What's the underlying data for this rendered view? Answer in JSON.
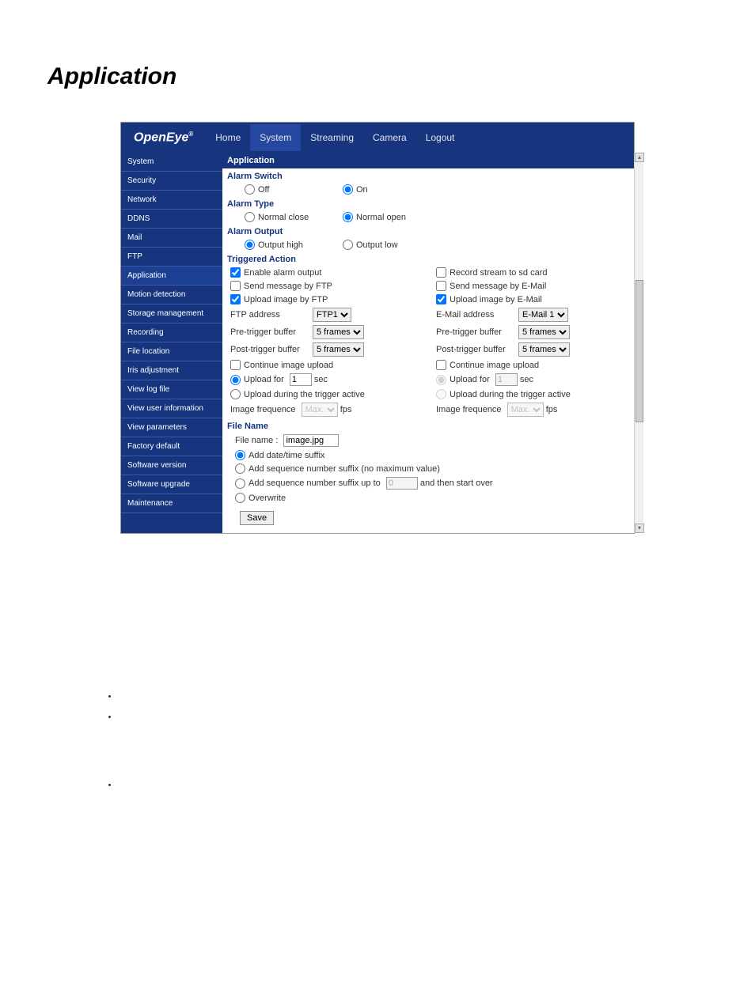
{
  "pageTitle": "Application",
  "logo": "OpenEye",
  "nav": [
    "Home",
    "System",
    "Streaming",
    "Camera",
    "Logout"
  ],
  "sidebar": [
    "System",
    "Security",
    "Network",
    "DDNS",
    "Mail",
    "FTP",
    "Application",
    "Motion detection",
    "Storage management",
    "Recording",
    "File location",
    "Iris adjustment",
    "View log file",
    "View user information",
    "View parameters",
    "Factory default",
    "Software version",
    "Software upgrade",
    "Maintenance"
  ],
  "contentTitle": "Application",
  "alarmSwitch": {
    "title": "Alarm Switch",
    "off": "Off",
    "on": "On"
  },
  "alarmType": {
    "title": "Alarm Type",
    "nc": "Normal close",
    "no": "Normal open"
  },
  "alarmOutput": {
    "title": "Alarm Output",
    "high": "Output high",
    "low": "Output low"
  },
  "triggered": {
    "title": "Triggered Action",
    "enableAlarm": "Enable alarm output",
    "recordSd": "Record stream to sd card",
    "sendFtp": "Send message by FTP",
    "sendEmail": "Send message by E-Mail",
    "upFtp": "Upload image by FTP",
    "upEmail": "Upload image by E-Mail",
    "ftpAddr": "FTP address",
    "ftpSel": "FTP1",
    "emailAddr": "E-Mail address",
    "emailSel": "E-Mail 1",
    "pre": "Pre-trigger buffer",
    "post": "Post-trigger buffer",
    "frames": "5 frames",
    "contUp": "Continue image upload",
    "upfor": "Upload for",
    "upforVal": "1",
    "sec": "sec",
    "upDuring": "Upload during the trigger active",
    "imgFreq": "Image frequence",
    "imgFreqSel": "Max.",
    "fps": "fps"
  },
  "fileName": {
    "title": "File Name",
    "label": "File name :",
    "value": "image.jpg",
    "addDate": "Add date/time suffix",
    "addSeqNoMax": "Add sequence number suffix (no maximum value)",
    "addSeqUpTo": "Add sequence number suffix up to",
    "seqVal": "0",
    "andThen": "and then start over",
    "overwrite": "Overwrite"
  },
  "save": "Save"
}
